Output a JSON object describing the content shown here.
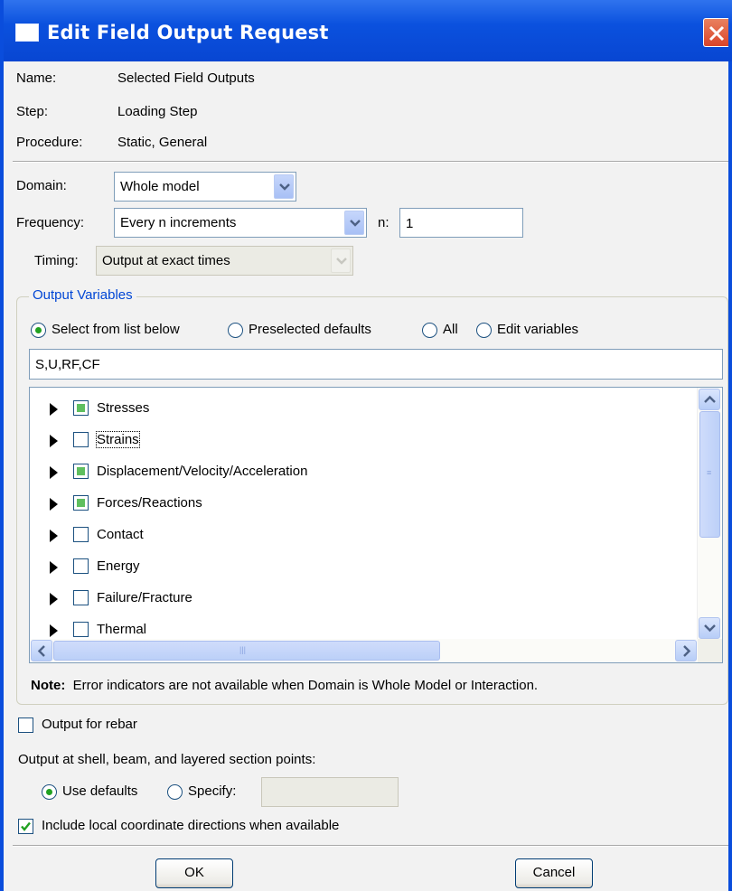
{
  "window": {
    "title": "Edit Field Output Request"
  },
  "info": {
    "name_label": "Name:",
    "name_value": "Selected Field Outputs",
    "step_label": "Step:",
    "step_value": "Loading Step",
    "procedure_label": "Procedure:",
    "procedure_value": "Static, General"
  },
  "domain": {
    "label": "Domain:",
    "value": "Whole model"
  },
  "frequency": {
    "label": "Frequency:",
    "value": "Every n increments",
    "n_label": "n:",
    "n_value": "1"
  },
  "timing": {
    "label": "Timing:",
    "value": "Output at exact times"
  },
  "output_variables": {
    "title": "Output Variables",
    "options": [
      "Select from list below",
      "Preselected defaults",
      "All",
      "Edit variables"
    ],
    "selected_index": 0,
    "variables_text": "S,U,RF,CF",
    "tree": [
      {
        "label": "Stresses",
        "state": "partial"
      },
      {
        "label": "Strains",
        "state": "unchecked"
      },
      {
        "label": "Displacement/Velocity/Acceleration",
        "state": "partial"
      },
      {
        "label": "Forces/Reactions",
        "state": "partial"
      },
      {
        "label": "Contact",
        "state": "unchecked"
      },
      {
        "label": "Energy",
        "state": "unchecked"
      },
      {
        "label": "Failure/Fracture",
        "state": "unchecked"
      },
      {
        "label": "Thermal",
        "state": "unchecked"
      }
    ],
    "note_bold": "Note:",
    "note_text": "Error indicators are not available when Domain is Whole Model or Interaction."
  },
  "rebar": {
    "label": "Output for rebar",
    "checked": false
  },
  "section_points": {
    "label": "Output at shell, beam, and layered section points:",
    "use_defaults": "Use defaults",
    "specify": "Specify:",
    "specify_value": ""
  },
  "local_coords": {
    "label": "Include local coordinate directions when available",
    "checked": true
  },
  "buttons": {
    "ok": "OK",
    "cancel": "Cancel"
  },
  "colors": {
    "titlebar": "#0b51de",
    "group_title": "#0046d5",
    "check_fill": "#5fbf5f",
    "close": "#d9442a"
  }
}
